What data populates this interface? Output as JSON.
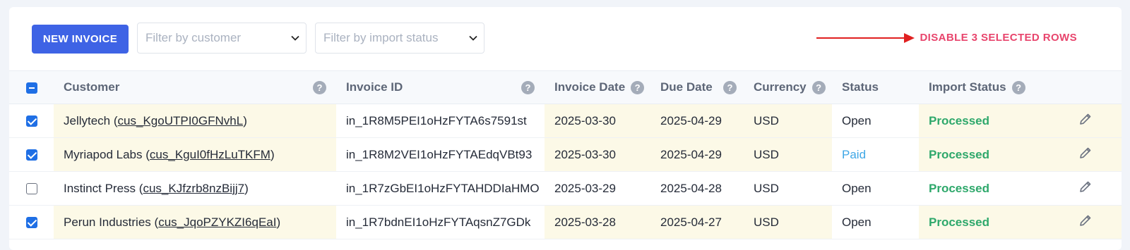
{
  "toolbar": {
    "new_invoice_label": "NEW INVOICE",
    "customer_filter_placeholder": "Filter by customer",
    "import_filter_placeholder": "Filter by import status",
    "disable_label": "DISABLE 3 SELECTED ROWS"
  },
  "colors": {
    "primary": "#3e63e5",
    "danger": "#e8446c",
    "selected_row": "#fcf9e7",
    "processed": "#2ea86b",
    "paid": "#3ea7e6"
  },
  "table": {
    "select_all_state": "indeterminate",
    "headers": {
      "customer": "Customer",
      "invoice_id": "Invoice ID",
      "invoice_date": "Invoice Date",
      "due_date": "Due Date",
      "currency": "Currency",
      "status": "Status",
      "import_status": "Import Status"
    },
    "help_glyph": "?",
    "rows": [
      {
        "selected": true,
        "customer_name": "Jellytech",
        "customer_id": "cus_KgoUTPI0GFNvhL",
        "invoice_id": "in_1R8M5PEI1oHzFYTA6s7591st",
        "invoice_date": "2025-03-30",
        "due_date": "2025-04-29",
        "currency": "USD",
        "status": "Open",
        "import_status": "Processed"
      },
      {
        "selected": true,
        "customer_name": "Myriapod Labs",
        "customer_id": "cus_KguI0fHzLuTKFM",
        "invoice_id": "in_1R8M2VEI1oHzFYTAEdqVBt93",
        "invoice_date": "2025-03-30",
        "due_date": "2025-04-29",
        "currency": "USD",
        "status": "Paid",
        "import_status": "Processed"
      },
      {
        "selected": false,
        "customer_name": "Instinct Press",
        "customer_id": "cus_KJfzrb8nzBijj7",
        "invoice_id": "in_1R7zGbEI1oHzFYTAHDDIaHMO",
        "invoice_date": "2025-03-29",
        "due_date": "2025-04-28",
        "currency": "USD",
        "status": "Open",
        "import_status": "Processed"
      },
      {
        "selected": true,
        "customer_name": "Perun Industries",
        "customer_id": "cus_JqoPZYKZI6qEaI",
        "invoice_id": "in_1R7bdnEI1oHzFYTAqsnZ7GDk",
        "invoice_date": "2025-03-28",
        "due_date": "2025-04-27",
        "currency": "USD",
        "status": "Open",
        "import_status": "Processed"
      }
    ]
  }
}
